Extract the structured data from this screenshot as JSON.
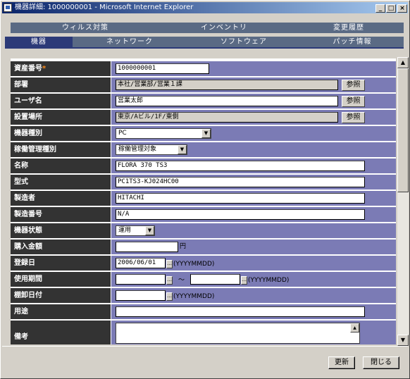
{
  "window": {
    "title": "機器詳細: 1000000001 - Microsoft Internet Explorer"
  },
  "tabs_top": [
    "ウィルス対策",
    "インベントリ",
    "変更履歴"
  ],
  "tabs_bottom": [
    "機器",
    "ネットワーク",
    "ソフトウェア",
    "パッチ情報"
  ],
  "fields": {
    "asset_no": {
      "label": "資産番号",
      "required_mark": "*",
      "value": "1000000001"
    },
    "department": {
      "label": "部署",
      "value": "本社/営業部/営業１課",
      "button": "参照"
    },
    "user_name": {
      "label": "ユーザ名",
      "value": "営業太郎",
      "button": "参照"
    },
    "location": {
      "label": "設置場所",
      "value": "東京/Aビル/1F/東側",
      "button": "参照"
    },
    "device_type": {
      "label": "機器種別",
      "value": "PC"
    },
    "operation_mgmt": {
      "label": "稼働管理種別",
      "value": "稼働管理対象"
    },
    "name": {
      "label": "名称",
      "value": "FLORA 370 TS3"
    },
    "model": {
      "label": "型式",
      "value": "PC1TS3-KJ024HC00"
    },
    "maker": {
      "label": "製造者",
      "value": "HITACHI"
    },
    "serial": {
      "label": "製造番号",
      "value": "N/A"
    },
    "status": {
      "label": "機器状態",
      "value": "運用"
    },
    "price": {
      "label": "購入金額",
      "value": "",
      "unit": "円"
    },
    "reg_date": {
      "label": "登録日",
      "value": "2006/06/01",
      "format": "(YYYYMMDD)"
    },
    "period": {
      "label": "使用期間",
      "from": "",
      "sep": "～",
      "to": "",
      "format": "(YYYYMMDD)"
    },
    "inventory_date": {
      "label": "棚卸日付",
      "value": "",
      "format": "(YYYYMMDD)"
    },
    "purpose": {
      "label": "用途",
      "value": ""
    },
    "remarks": {
      "label": "備考",
      "value": ""
    }
  },
  "footer": {
    "update": "更新",
    "close": "閉じる"
  },
  "icons": {
    "dropdown": "▼",
    "cal": "…",
    "scroll_up": "▲",
    "scroll_down": "▼"
  }
}
